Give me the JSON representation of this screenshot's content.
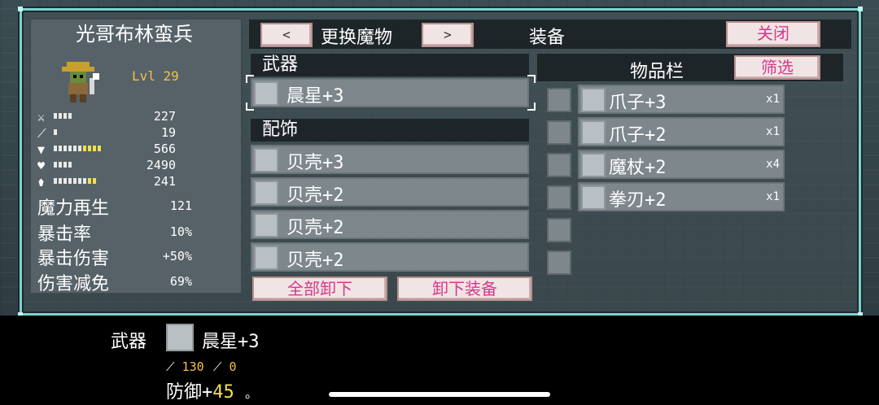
{
  "character": {
    "name": "光哥布林蛮兵",
    "level": "Lvl 29",
    "stats": [
      {
        "icon": "sword-icon",
        "value": "227",
        "bars": 4,
        "yellow": 0
      },
      {
        "icon": "wand-icon",
        "value": "19",
        "bars": 1,
        "yellow": 0
      },
      {
        "icon": "shield-icon",
        "value": "566",
        "bars": 6,
        "yellow": 4
      },
      {
        "icon": "heart-icon",
        "value": "2490",
        "bars": 4,
        "yellow": 0
      },
      {
        "icon": "potion-icon",
        "value": "241",
        "bars": 7,
        "yellow": 2
      }
    ],
    "text_stats": [
      {
        "label": "魔力再生",
        "value": "121"
      },
      {
        "label": "暴击率",
        "value": "10%"
      },
      {
        "label": "暴击伤害",
        "value": "+50%"
      },
      {
        "label": "伤害减免",
        "value": "69%"
      }
    ]
  },
  "topbar": {
    "prev": "<",
    "title": "更换魔物",
    "next": ">",
    "equip_title": "装备",
    "close": "关闭"
  },
  "sections": {
    "weapon": "武器",
    "accessory": "配饰",
    "inventory": "物品栏",
    "filter": "筛选"
  },
  "weapon_items": [
    {
      "name": "晨星+3",
      "icon": "morningstar-icon"
    }
  ],
  "accessory_items": [
    {
      "name": "贝壳+3",
      "icon": "shell-icon"
    },
    {
      "name": "贝壳+2",
      "icon": "shell-icon"
    },
    {
      "name": "贝壳+2",
      "icon": "shell-icon"
    },
    {
      "name": "贝壳+2",
      "icon": "shell-icon"
    }
  ],
  "buttons": {
    "unequip_all": "全部卸下",
    "unequip": "卸下装备"
  },
  "inventory_items": [
    {
      "name": "爪子+3",
      "qty": "x1",
      "icon": "claw-icon"
    },
    {
      "name": "爪子+2",
      "qty": "x1",
      "icon": "claw-icon"
    },
    {
      "name": "魔杖+2",
      "qty": "x4",
      "icon": "wand-icon"
    },
    {
      "name": "拳刃+2",
      "qty": "x1",
      "icon": "fist-blade-icon"
    }
  ],
  "filter_icons": [
    "gauntlet-icon",
    "claw-icon",
    "gauntlet-icon",
    "wand-icon",
    "claw-icon",
    "claw-icon"
  ],
  "tooltip": {
    "slot_label": "武器",
    "item_name": "晨星+3",
    "atk": "130",
    "mag": "0",
    "defense_label": "防御+",
    "defense_value": "45",
    "dot": "。"
  },
  "colors": {
    "frame": "#7fd0d0",
    "button_text": "#d43a8c",
    "level": "#f2c04a",
    "highlight": "#f2e04a"
  }
}
